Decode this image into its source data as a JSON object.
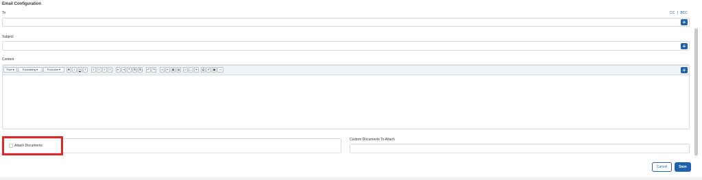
{
  "section": {
    "title": "Email Configuration"
  },
  "to": {
    "label": "To",
    "value": "",
    "cc_label": "CC",
    "separator": "|",
    "bcc_label": "BCC",
    "add_symbol": "+"
  },
  "subject": {
    "label": "Subject",
    "value": "",
    "add_symbol": "+"
  },
  "content": {
    "label": "Content",
    "add_symbol": "+",
    "body": "",
    "toolbar": {
      "dropdowns": [
        "Font ▾",
        "Formatting ▾",
        "Font size ▾"
      ],
      "buttons": [
        "B",
        "I",
        "U",
        "T",
        "≡",
        "≡",
        "≡",
        "≡",
        "⇤",
        "⇥",
        "❝",
        "☰",
        "☰",
        "↶",
        "↷",
        "∞",
        "✂",
        "▦",
        "▤",
        "☺",
        "—",
        "✶",
        "⎙",
        "✐",
        "▣",
        "‹›"
      ]
    }
  },
  "attach": {
    "checkbox_label": "Attach Documents",
    "value": ""
  },
  "custom_docs": {
    "label": "Custom Documents To Attach",
    "value": ""
  },
  "actions": {
    "cancel_label": "Cancel",
    "save_label": "Save"
  },
  "colors": {
    "accent": "#1f62ae",
    "highlight": "#e0282b"
  }
}
